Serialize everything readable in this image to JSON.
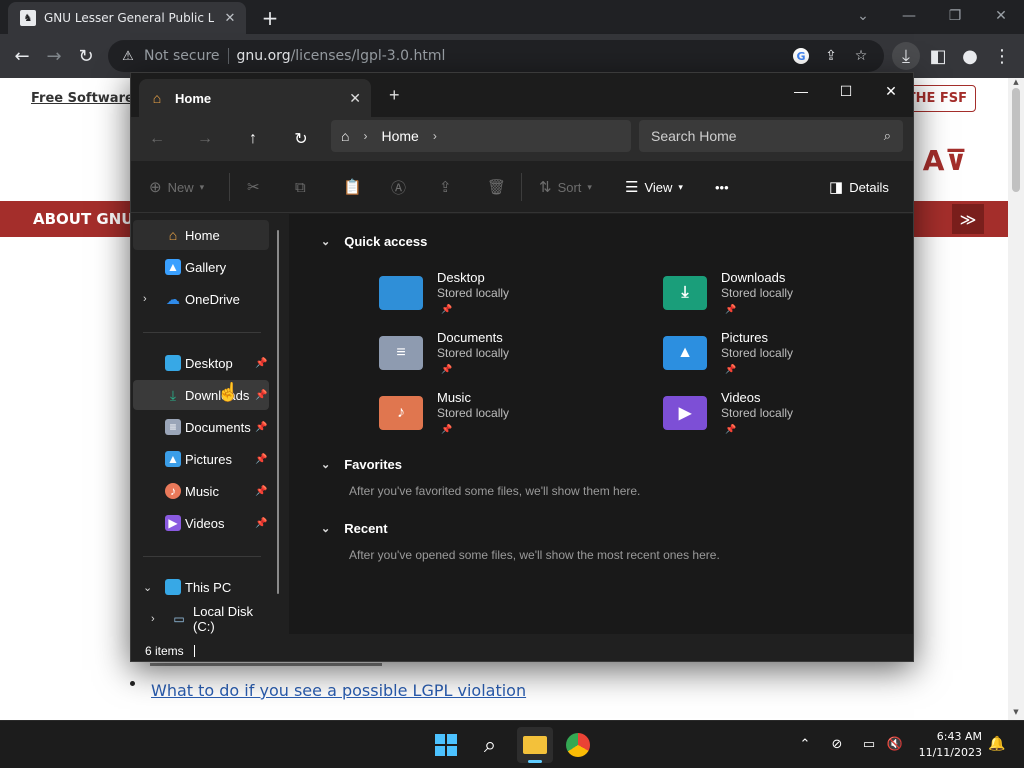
{
  "chrome": {
    "tab_title": "GNU Lesser General Public Licen",
    "favicon": "gnu-head-icon",
    "new_tab": "+",
    "window_controls": [
      "chevron-down-icon",
      "minimize-icon",
      "restore-icon",
      "close-icon"
    ],
    "omnibox": {
      "security": "Not secure",
      "url_host": "gnu.org",
      "url_path": "/licenses/lgpl-3.0.html"
    }
  },
  "webpage": {
    "nav_link": "Free Software",
    "join_button": "THE FSF",
    "banner": "ABOUT GNU",
    "more_button": "≫",
    "list_link": "What to do if you see a possible LGPL violation"
  },
  "explorer": {
    "tab_title": "Home",
    "address": {
      "crumb": "Home"
    },
    "search_placeholder": "Search Home",
    "commands": {
      "new": "New",
      "sort": "Sort",
      "view": "View",
      "more": "•••",
      "details": "Details"
    },
    "sidebar": {
      "top": [
        {
          "label": "Home",
          "icon": "home-icon",
          "color": "#f3a847"
        },
        {
          "label": "Gallery",
          "icon": "gallery-icon",
          "color": "#3aa0ff"
        },
        {
          "label": "OneDrive",
          "icon": "cloud-icon",
          "color": "#2f8bea"
        }
      ],
      "pinned": [
        {
          "label": "Desktop",
          "icon": "desktop-icon",
          "color": "#37a8e6"
        },
        {
          "label": "Downloads",
          "icon": "download-icon",
          "color": "#28b38c"
        },
        {
          "label": "Documents",
          "icon": "documents-icon",
          "color": "#9aa5b8"
        },
        {
          "label": "Pictures",
          "icon": "pictures-icon",
          "color": "#3b9ee8"
        },
        {
          "label": "Music",
          "icon": "music-icon",
          "color": "#e9795a"
        },
        {
          "label": "Videos",
          "icon": "videos-icon",
          "color": "#8a5ae0"
        }
      ],
      "this_pc": "This PC",
      "local_disk": "Local Disk (C:)"
    },
    "sections": {
      "quick_access": "Quick access",
      "favorites": "Favorites",
      "favorites_empty": "After you've favorited some files, we'll show them here.",
      "recent": "Recent",
      "recent_empty": "After you've opened some files, we'll show the most recent ones here."
    },
    "quick_access": [
      {
        "name": "Desktop",
        "sub": "Stored locally",
        "color": "#2f8fd8",
        "icon": "desktop-folder-icon"
      },
      {
        "name": "Downloads",
        "sub": "Stored locally",
        "color": "#1a9e7a",
        "icon": "downloads-folder-icon"
      },
      {
        "name": "Documents",
        "sub": "Stored locally",
        "color": "#8e9bb0",
        "icon": "documents-folder-icon"
      },
      {
        "name": "Pictures",
        "sub": "Stored locally",
        "color": "#2c8fe0",
        "icon": "pictures-folder-icon"
      },
      {
        "name": "Music",
        "sub": "Stored locally",
        "color": "#e0764f",
        "icon": "music-folder-icon"
      },
      {
        "name": "Videos",
        "sub": "Stored locally",
        "color": "#7d4fd6",
        "icon": "videos-folder-icon"
      }
    ],
    "status": "6 items"
  },
  "taskbar": {
    "time": "6:43 AM",
    "date": "11/11/2023"
  }
}
